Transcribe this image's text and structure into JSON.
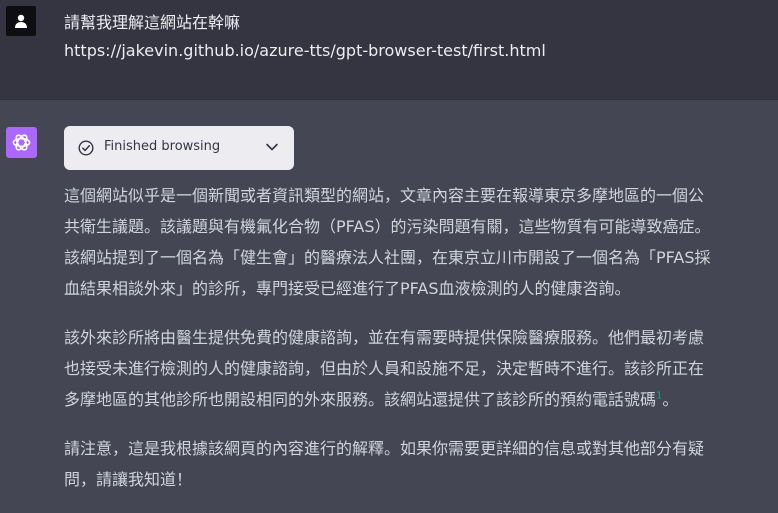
{
  "user": {
    "avatar_icon": "user-icon",
    "lines": [
      "請幫我理解這網站在幹嘛",
      "https://jakevin.github.io/azure-tts/gpt-browser-test/first.html"
    ]
  },
  "assistant": {
    "avatar_icon": "openai-logo-icon",
    "avatar_color": "#ab68ff",
    "browsing": {
      "label": "Finished browsing",
      "status_icon": "check-circle-icon",
      "toggle_icon": "chevron-down-icon"
    },
    "paragraphs": [
      {
        "lines": [
          "這個網站似乎是一個新聞或者資訊類型的網站，文章內容主要在報導東京多摩地區的一個公",
          "共衛生議題。該議題與有機氟化合物（PFAS）的污染問題有關，這些物質有可能導致癌症。",
          "該網站提到了一個名為「健生會」的醫療法人社團，在東京立川市開設了一個名為「PFAS採",
          "血結果相談外來」的診所，專門接受已經進行了PFAS血液檢測的人的健康咨詢。"
        ]
      },
      {
        "lines": [
          "該外來診所將由醫生提供免費的健康諮詢，並在有需要時提供保險醫療服務。他們最初考慮",
          "也接受未進行檢測的人的健康諮詢，但由於人員和設施不足，決定暫時不進行。該診所正在",
          "多摩地區的其他診所也開設相同的外來服務。該網站還提供了該診所的預約電話號碼"
        ],
        "citation": "1",
        "end_punct": "。"
      },
      {
        "lines": [
          "請注意，這是我根據該網頁的內容進行的解釋。如果你需要更詳細的信息或對其他部分有疑",
          "問，請讓我知道！"
        ]
      }
    ]
  }
}
